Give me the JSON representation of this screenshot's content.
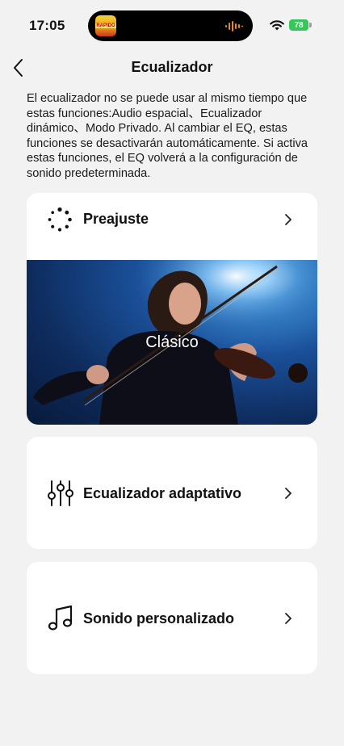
{
  "status_bar": {
    "time": "17:05",
    "battery": "78",
    "island_app_text": "RAPIDO"
  },
  "header": {
    "title": "Ecualizador",
    "back_icon": "chevron-left-icon"
  },
  "notice": "El ecualizador no se puede usar al mismo tiempo que estas funciones:Audio espacial、Ecualizador dinámico、Modo Privado. Al cambiar el EQ, estas funciones se desactivarán automáticamente. Si activa estas funciones, el EQ volverá a la configuración de sonido predeterminada.",
  "preset": {
    "label": "Preajuste",
    "icon": "loading-dots-icon",
    "selected_name": "Clásico"
  },
  "adaptive": {
    "label": "Ecualizador adaptativo",
    "icon": "sliders-icon"
  },
  "custom": {
    "label": "Sonido personalizado",
    "icon": "music-note-icon"
  },
  "colors": {
    "background": "#f2f2f2",
    "card": "#ffffff",
    "battery": "#35c759",
    "banner_blue": "#1a4f98"
  }
}
